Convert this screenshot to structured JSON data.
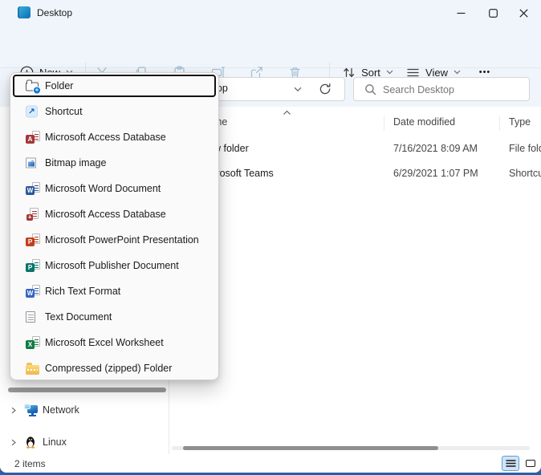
{
  "window": {
    "title": "Desktop"
  },
  "toolbar": {
    "new_label": "New",
    "sort_label": "Sort",
    "view_label": "View",
    "more_label": "•••"
  },
  "address_bar": {
    "path": "Desktop",
    "search_placeholder": "Search Desktop"
  },
  "columns": {
    "name": "Name",
    "date_modified": "Date modified",
    "type": "Type"
  },
  "files": [
    {
      "name": "New folder",
      "date_modified": "7/16/2021 8:09 AM",
      "type": "File folder"
    },
    {
      "name": "Microsoft Teams",
      "date_modified": "6/29/2021 1:07 PM",
      "type": "Shortcut"
    }
  ],
  "new_menu": {
    "items": [
      {
        "label": "Folder",
        "icon": "new-folder",
        "letter": "",
        "focused": true
      },
      {
        "label": "Shortcut",
        "icon": "shortcut",
        "letter": "↗",
        "focused": false
      },
      {
        "label": "Microsoft Access Database",
        "icon": "access-database",
        "letter": "A",
        "focused": false
      },
      {
        "label": "Bitmap image",
        "icon": "bitmap-image",
        "letter": "",
        "focused": false
      },
      {
        "label": "Microsoft Word Document",
        "icon": "word-document",
        "letter": "W",
        "focused": false
      },
      {
        "label": "Microsoft Access Database",
        "icon": "access-database-doc",
        "letter": "a",
        "focused": false
      },
      {
        "label": "Microsoft PowerPoint Presentation",
        "icon": "powerpoint",
        "letter": "P",
        "focused": false
      },
      {
        "label": "Microsoft Publisher Document",
        "icon": "publisher",
        "letter": "P",
        "focused": false
      },
      {
        "label": "Rich Text Format",
        "icon": "rich-text",
        "letter": "W",
        "focused": false
      },
      {
        "label": "Text Document",
        "icon": "text-document",
        "letter": "",
        "focused": false
      },
      {
        "label": "Microsoft Excel Worksheet",
        "icon": "excel-worksheet",
        "letter": "X",
        "focused": false
      },
      {
        "label": "Compressed (zipped) Folder",
        "icon": "zip-folder",
        "letter": "",
        "focused": false
      }
    ]
  },
  "sidebar": {
    "items": [
      {
        "label": "Network"
      },
      {
        "label": "Linux"
      }
    ]
  },
  "status_bar": {
    "items_count": "2 items"
  },
  "glyphs": {
    "plus": "+"
  },
  "colors": {
    "accent_blue": "#0b76d6",
    "header_bg": "#eff5fb",
    "word_blue": "#2b579a",
    "excel_green": "#107c41",
    "powerpoint_red": "#c43e1c",
    "publisher_teal": "#077568",
    "access_maroon": "#a4373a",
    "rtf_blue": "#3565c0",
    "zip_yellow": "#f0c24f",
    "window_edge_blue": "#2a5ea7",
    "disabled_toolbar_icon": "#a3bdd1"
  }
}
